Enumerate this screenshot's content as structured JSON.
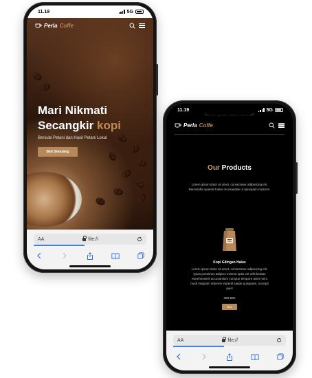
{
  "status": {
    "time": "11.19",
    "network": "5G"
  },
  "brand": {
    "name_a": "Perla",
    "name_b": "Coffe"
  },
  "hero": {
    "title_line1": "Mari Nikmati",
    "title_line2a": "Secangkir ",
    "title_line2b": "kopi",
    "subtitle": "Bersubi Petani dan Hasil Petani Lokal",
    "cta_label": "Beli Sekarang"
  },
  "products": {
    "ghost_text": "Lorem ipsum dolor sit amet",
    "title_a": "Our ",
    "title_b": "Products",
    "description": "Lorem ipsum dolor sit amet, consectetur adipisicing elit. Reiciendis quaerat totam recusandae ut quisquam nostrum.",
    "item": {
      "name": "Kopi Gilingan Halus",
      "description": "Lorem ipsum dolor sit amet, consectetur adipisicing elit. Quas possimus adipisci minima optio vel velit beatae reprehenderit accusantium cumque tempore animi vero modi magnam dolorem impedit saepe quisquam, suscipit quis!",
      "price": "IDR 50K",
      "button_label": "Beli"
    }
  },
  "browser": {
    "aa": "AA",
    "url": "file://",
    "load_progress": 0.45
  },
  "colors": {
    "accent": "#b6895b",
    "hero_accent": "#c08a55",
    "products_accent": "#c9a37a"
  }
}
